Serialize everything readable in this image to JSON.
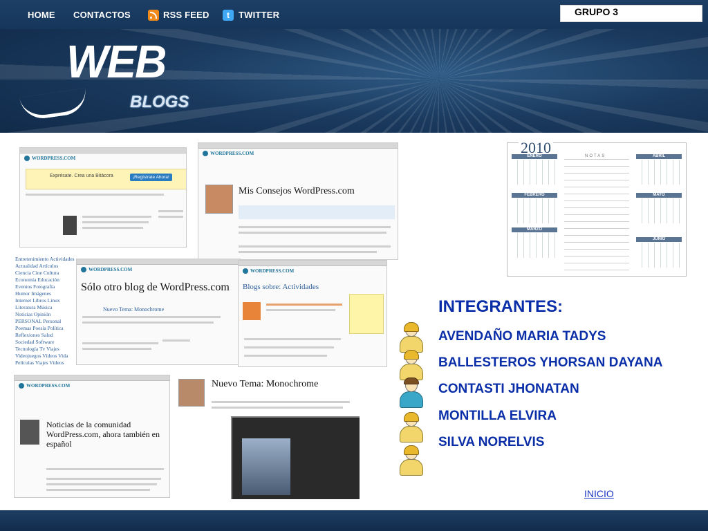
{
  "nav": {
    "home": "HOME",
    "contactos": "CONTACTOS",
    "rss": "RSS FEED",
    "twitter": "TWITTER"
  },
  "group_label": "GRUPO 3",
  "logo": {
    "main": "WEB",
    "sub": "BLOGS"
  },
  "screenshots": {
    "s1_banner": "Exprésate. Crea una Bitácora",
    "s1_button": "¡Regístrate Ahora!",
    "s2_title": "Mis Consejos WordPress.com",
    "s3_title": "Sólo otro blog de WordPress.com",
    "s3_sub": "Nuevo Tema: Monochrome",
    "s4_title": "Blogs sobre: Actividades",
    "s5_title": "Noticias de la comunidad WordPress.com, ahora también en español",
    "s6_title": "Nuevo Tema: Monochrome",
    "tag_cloud": [
      "Entretenimiento Actividades",
      "Actualidad Artículos",
      "Ciencia Cine Cultura",
      "Economía Educación",
      "Eventos Fotografía",
      "Humor Imágenes",
      "Internet Libros Linux",
      "Literatura Música",
      "Noticias Opinión",
      "PERSONAL Personal",
      "Poemas Poesía Política",
      "Reflexiones Salud",
      "Sociedad Software",
      "Tecnología Tv Viajes",
      "Videojuegos Vídeos Vida",
      "Películas Viajes Vídeos"
    ]
  },
  "calendar": {
    "year": "2010",
    "notes_label": "NOTAS",
    "months": [
      "ENERO",
      "FEBRERO",
      "MARZO",
      "ABRIL",
      "MAYO",
      "JUNIO"
    ]
  },
  "members": {
    "title": "INTEGRANTES:",
    "names": [
      "AVENDAÑO MARIA TADYS",
      "BALLESTEROS YHORSAN DAYANA",
      "CONTASTI JHONATAN",
      "MONTILLA ELVIRA",
      "SILVA NORELVIS"
    ]
  },
  "inicio_link": "INICIO",
  "colors": {
    "header_bg": "#1a3a5e",
    "member_text": "#0a2ea8",
    "link": "#1a36c4"
  }
}
